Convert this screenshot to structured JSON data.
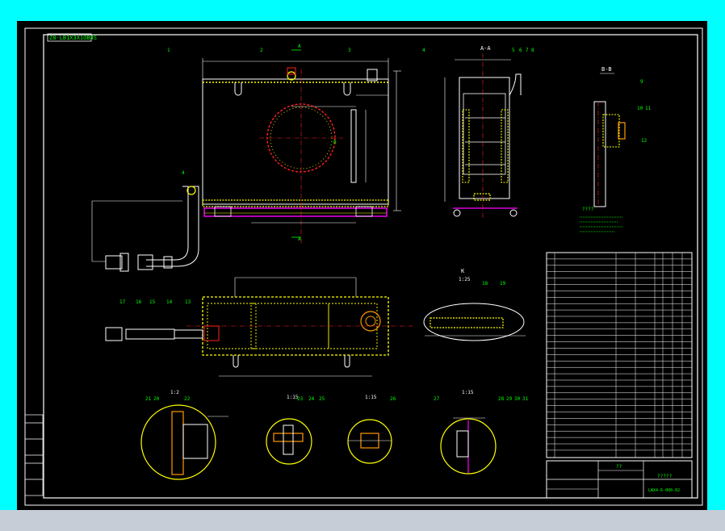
{
  "colors": {
    "frame": "#00ffff",
    "background": "#000000",
    "white": "#ffffff",
    "yellow": "#ffff00",
    "red": "#ff2020",
    "green": "#00ff00",
    "cyan": "#00ffff",
    "magenta": "#ff00ff",
    "orange": "#ff9900",
    "bottom_band": "#c6cdd6"
  },
  "drawing": {
    "title_stamp": "Z8-LB1X3X1OB4S",
    "section_aa": "A-A",
    "section_bb": "B-B",
    "view_k": "K",
    "scale_k": "1:25",
    "detail_1_scale": "1:2",
    "detail_2_scale": "1:15",
    "detail_3_scale": "1:15",
    "detail_4_scale": "1:15",
    "tech_req_title": "????",
    "tb_name": "?????",
    "tb_number": "LWX4-6-000-02",
    "tb_company": "??"
  },
  "balloons": {
    "top_view": [
      "1",
      "2",
      "3",
      "4"
    ],
    "section_aa": [
      "4",
      "5",
      "6",
      "7",
      "8"
    ],
    "section_bb": [
      "9",
      "10",
      "11",
      "12"
    ],
    "pipe": [
      "17",
      "16",
      "15",
      "14",
      "13"
    ],
    "view_k": [
      "18",
      "19"
    ],
    "detail_1": [
      "21",
      "20",
      "22"
    ],
    "detail_2": [
      "23",
      "24",
      "25"
    ],
    "detail_3": [
      "26"
    ],
    "detail_4": [
      "27",
      "28",
      "29",
      "30",
      "31"
    ]
  }
}
